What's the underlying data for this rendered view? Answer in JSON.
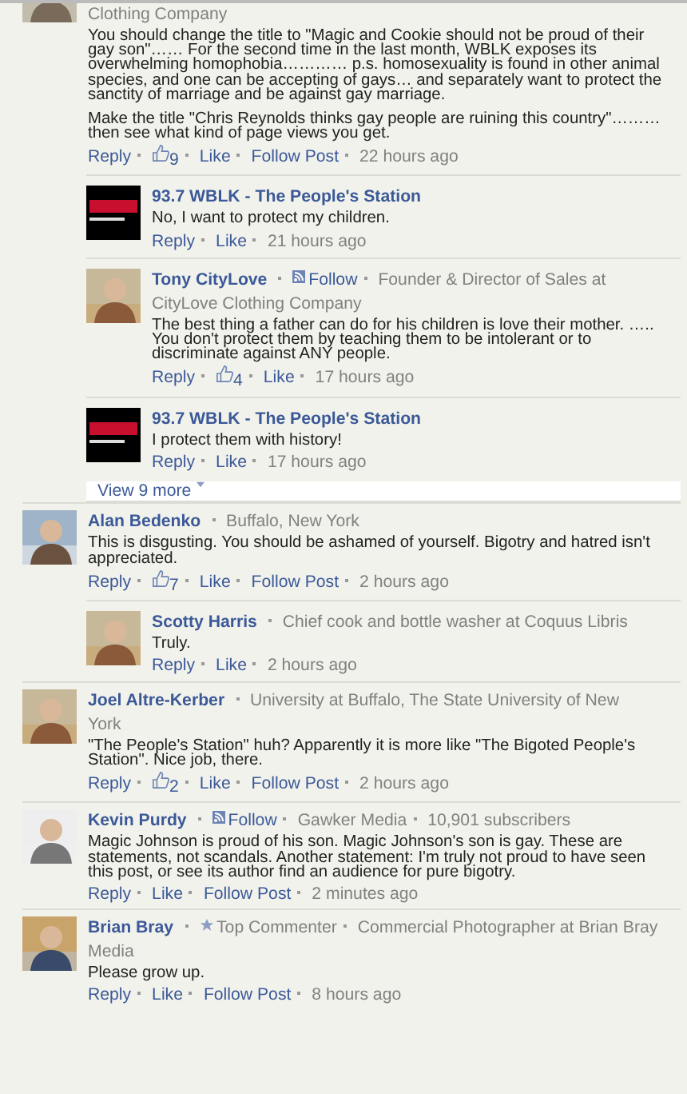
{
  "comments": [
    {
      "avatar": {
        "kind": "picture"
      },
      "meta": [
        {
          "kind": "info",
          "text": "Clothing Company"
        }
      ],
      "body": [
        "You should change the title to \"Magic and Cookie should not be proud of their gay son\"…… For the second time in the last month, WBLK exposes its overwhelming homophobia………… p.s. homosexuality is found in other animal species, and one can be accepting of gays… and separately want to protect the sanctity of marriage and be against gay marriage.",
        "Make the title \"Chris Reynolds thinks gay people are ruining this country\"……… then see what kind of page views you get."
      ],
      "actions": [
        {
          "kind": "link",
          "text": "Reply"
        },
        {
          "kind": "likes",
          "text": "9"
        },
        {
          "kind": "link",
          "text": "Like"
        },
        {
          "kind": "link",
          "text": "Follow Post"
        },
        {
          "kind": "time",
          "text": "22 hours ago"
        }
      ],
      "replies": [
        {
          "avatar": {
            "kind": "logo"
          },
          "name": "93.7 WBLK - The People's Station",
          "body": [
            "No, I want to protect my children."
          ],
          "actions": [
            {
              "kind": "link",
              "text": "Reply"
            },
            {
              "kind": "link",
              "text": "Like"
            },
            {
              "kind": "time",
              "text": "21 hours ago"
            }
          ]
        },
        {
          "avatar": {
            "kind": "picture"
          },
          "name": "Tony CityLove",
          "meta": [
            {
              "kind": "follow",
              "text": "Follow"
            },
            {
              "kind": "info",
              "lines": [
                "Founder & Director of Sales at",
                "CityLove Clothing Company"
              ]
            }
          ],
          "body": [
            "The best thing a father can do for his children is love their mother. ….. You don't protect them by teaching them to be intolerant or to discriminate against ANY people."
          ],
          "actions": [
            {
              "kind": "link",
              "text": "Reply"
            },
            {
              "kind": "likes",
              "text": "4"
            },
            {
              "kind": "link",
              "text": "Like"
            },
            {
              "kind": "time",
              "text": "17 hours ago"
            }
          ]
        },
        {
          "avatar": {
            "kind": "logo"
          },
          "name": "93.7 WBLK - The People's Station",
          "body": [
            "I protect them with history!"
          ],
          "actions": [
            {
              "kind": "link",
              "text": "Reply"
            },
            {
              "kind": "link",
              "text": "Like"
            },
            {
              "kind": "time",
              "text": "17 hours ago"
            }
          ]
        }
      ],
      "view_more": "View 9 more"
    },
    {
      "avatar": {
        "kind": "picture"
      },
      "name": "Alan Bedenko",
      "meta": [
        {
          "kind": "info",
          "text": "Buffalo, New York"
        }
      ],
      "body": [
        "This is disgusting. You should be ashamed of yourself. Bigotry and hatred isn't appreciated."
      ],
      "actions": [
        {
          "kind": "link",
          "text": "Reply"
        },
        {
          "kind": "likes",
          "text": "7"
        },
        {
          "kind": "link",
          "text": "Like"
        },
        {
          "kind": "link",
          "text": "Follow Post"
        },
        {
          "kind": "time",
          "text": "2 hours ago"
        }
      ],
      "replies": [
        {
          "avatar": {
            "kind": "picture"
          },
          "name": "Scotty Harris",
          "meta": [
            {
              "kind": "info",
              "text": "Chief cook and bottle washer at Coquus Libris"
            }
          ],
          "body": [
            "Truly."
          ],
          "actions": [
            {
              "kind": "link",
              "text": "Reply"
            },
            {
              "kind": "link",
              "text": "Like"
            },
            {
              "kind": "time",
              "text": "2 hours ago"
            }
          ]
        }
      ]
    },
    {
      "avatar": {
        "kind": "picture"
      },
      "name": "Joel Altre-Kerber",
      "meta": [
        {
          "kind": "info",
          "lines": [
            "University at Buffalo, The State University of New",
            "York"
          ]
        }
      ],
      "body": [
        "\"The People's Station\" huh? Apparently it is more like \"The Bigoted People's Station\". Nice job, there."
      ],
      "actions": [
        {
          "kind": "link",
          "text": "Reply"
        },
        {
          "kind": "likes",
          "text": "2"
        },
        {
          "kind": "link",
          "text": "Like"
        },
        {
          "kind": "link",
          "text": "Follow Post"
        },
        {
          "kind": "time",
          "text": "2 hours ago"
        }
      ]
    },
    {
      "avatar": {
        "kind": "picture"
      },
      "name": "Kevin Purdy",
      "meta": [
        {
          "kind": "follow",
          "text": "Follow"
        },
        {
          "kind": "info",
          "text": "Gawker Media"
        },
        {
          "kind": "info",
          "text": "10,901 subscribers"
        }
      ],
      "body": [
        "Magic Johnson is proud of his son. Magic Johnson's son is gay. These are statements, not scandals. Another statement: I'm truly not proud to have seen this post, or see its author find an audience for pure bigotry."
      ],
      "actions": [
        {
          "kind": "link",
          "text": "Reply"
        },
        {
          "kind": "link",
          "text": "Like"
        },
        {
          "kind": "link",
          "text": "Follow Post"
        },
        {
          "kind": "time",
          "text": "2 minutes ago"
        }
      ]
    },
    {
      "avatar": {
        "kind": "picture"
      },
      "name": "Brian Bray",
      "meta": [
        {
          "kind": "badge",
          "text": "Top Commenter"
        },
        {
          "kind": "info",
          "lines": [
            "Commercial Photographer at Brian Bray",
            "Media"
          ]
        }
      ],
      "body": [
        "Please grow up."
      ],
      "actions": [
        {
          "kind": "link",
          "text": "Reply"
        },
        {
          "kind": "link",
          "text": "Like"
        },
        {
          "kind": "link",
          "text": "Follow Post"
        },
        {
          "kind": "time",
          "text": "8 hours ago"
        }
      ]
    }
  ]
}
